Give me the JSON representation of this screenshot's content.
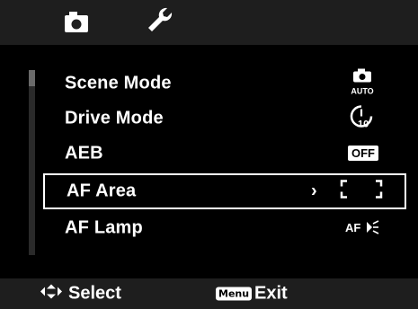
{
  "tabs": [
    {
      "name": "camera",
      "icon": "camera-icon",
      "active": true
    },
    {
      "name": "setup",
      "icon": "wrench-icon",
      "active": false
    }
  ],
  "menu": {
    "items": [
      {
        "label": "Scene Mode",
        "value_icon": "scene-auto-icon",
        "value_text": "AUTO"
      },
      {
        "label": "Drive Mode",
        "value_icon": "self-timer-10s-icon",
        "value_text": "10"
      },
      {
        "label": "AEB",
        "value_icon": "off-badge-icon",
        "value_text": "OFF"
      },
      {
        "label": "AF Area",
        "value_icon": "af-area-brackets-icon",
        "value_text": "",
        "selected": true
      },
      {
        "label": "AF Lamp",
        "value_icon": "af-lamp-icon",
        "value_text": "AF"
      }
    ]
  },
  "footer": {
    "select_label": "Select",
    "menu_button_label": "Menu",
    "exit_label": "Exit"
  },
  "colors": {
    "background": "#000000",
    "bar": "#1e1e1e",
    "text": "#ffffff",
    "scrollbar_track": "#2a2a2a",
    "scrollbar_thumb": "#6a6a6a"
  }
}
